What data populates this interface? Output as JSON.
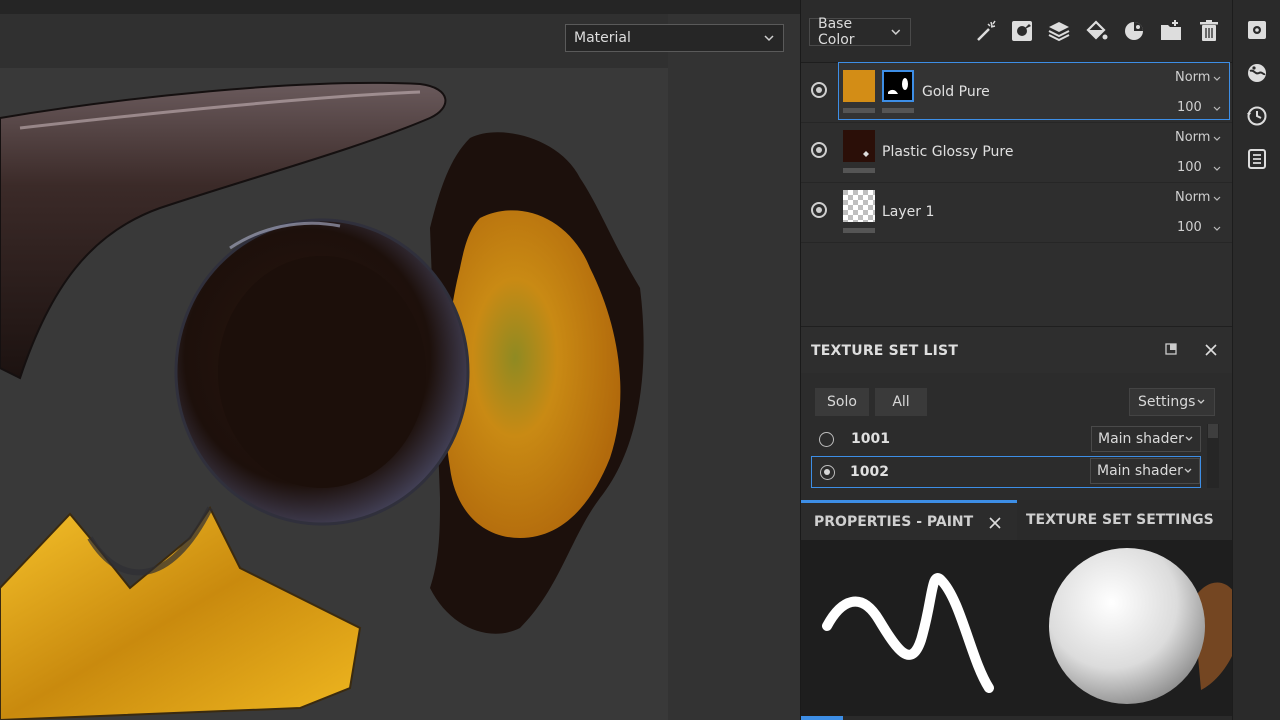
{
  "viewport": {
    "material_select": "Material"
  },
  "layers": {
    "channel_select": "Base Color",
    "toolbar_icons": [
      "magic-wand-icon",
      "mask-icon",
      "layer-stack-icon",
      "fill-bucket-icon",
      "smart-material-icon",
      "folder-add-icon",
      "trash-icon"
    ],
    "items": [
      {
        "name": "Gold Pure",
        "blend": "Norm",
        "opacity": "100",
        "selected": true,
        "color": "#c8861a"
      },
      {
        "name": "Plastic Glossy Pure",
        "blend": "Norm",
        "opacity": "100",
        "selected": false,
        "color": "#2b0f08"
      },
      {
        "name": "Layer 1",
        "blend": "Norm",
        "opacity": "100",
        "selected": false,
        "color": "checker"
      }
    ]
  },
  "texture_set_list": {
    "title": "TEXTURE SET LIST",
    "solo_label": "Solo",
    "all_label": "All",
    "settings_label": "Settings",
    "sets": [
      {
        "name": "1001",
        "shader": "Main shader",
        "active": false
      },
      {
        "name": "1002",
        "shader": "Main shader",
        "active": true
      }
    ]
  },
  "properties": {
    "tab_paint": "PROPERTIES - PAINT",
    "tab_texture_set_settings": "TEXTURE SET SETTINGS"
  },
  "sidebar_icons": [
    "display-settings-icon",
    "environment-icon",
    "history-icon",
    "log-icon"
  ],
  "colors": {
    "accent": "#3d8ee6",
    "gold": "#e2a21c",
    "dark_plastic": "#2b0f08"
  }
}
